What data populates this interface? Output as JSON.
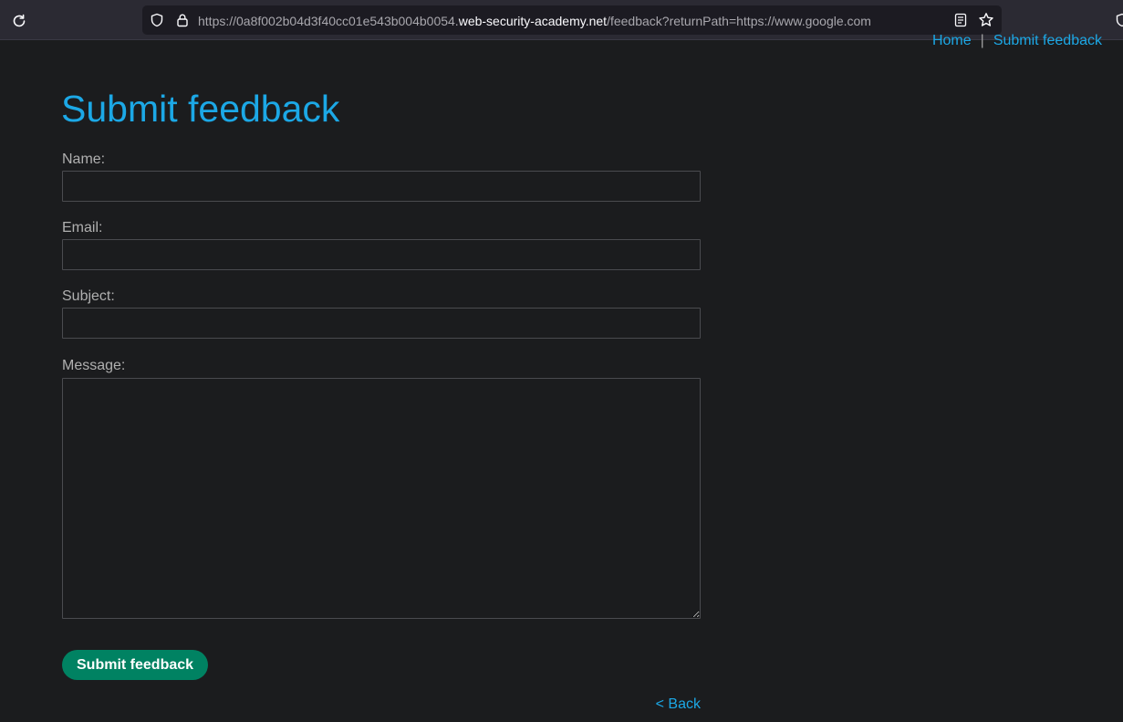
{
  "browser": {
    "url_prefix": "https://0a8f002b04d3f40cc01e543b004b0054.",
    "url_domain": "web-security-academy.net",
    "url_path": "/feedback?returnPath=https://www.google.com",
    "icons": [
      "reload-icon",
      "shield-icon",
      "lock-icon",
      "reader-view-icon",
      "bookmark-star-icon"
    ]
  },
  "nav": {
    "home": "Home",
    "separator": "|",
    "submit_feedback": "Submit feedback"
  },
  "page": {
    "title": "Submit feedback"
  },
  "form": {
    "name_label": "Name:",
    "name_value": "",
    "email_label": "Email:",
    "email_value": "",
    "subject_label": "Subject:",
    "subject_value": "",
    "message_label": "Message:",
    "message_value": "",
    "submit_label": "Submit feedback"
  },
  "back_link": "< Back",
  "colors": {
    "background": "#1b1c1e",
    "link": "#1ca8e6",
    "button": "#008262",
    "label": "#b0b0b0"
  }
}
